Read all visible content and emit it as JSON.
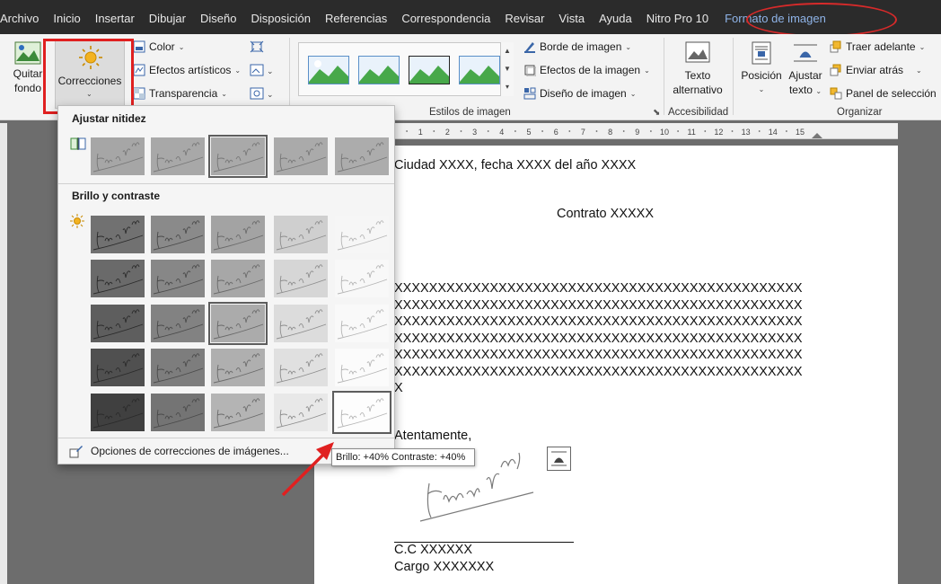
{
  "menu": {
    "tabs": [
      "Archivo",
      "Inicio",
      "Insertar",
      "Dibujar",
      "Diseño",
      "Disposición",
      "Referencias",
      "Correspondencia",
      "Revisar",
      "Vista",
      "Ayuda",
      "Nitro Pro 10"
    ],
    "active_tab": "Formato de imagen"
  },
  "ribbon": {
    "quitar_fondo": [
      "Quitar",
      "fondo"
    ],
    "correcciones": "Correcciones",
    "color": "Color",
    "efectos_artisticos": "Efectos artísticos",
    "transparencia": "Transparencia",
    "borde_imagen": "Borde de imagen",
    "efectos_imagen": "Efectos de la imagen",
    "diseno_imagen": "Diseño de imagen",
    "estilos_label": "Estilos de imagen",
    "texto_alternativo": [
      "Texto",
      "alternativo"
    ],
    "accesibilidad_label": "Accesibilidad",
    "posicion": "Posición",
    "ajustar_texto": [
      "Ajustar",
      "texto"
    ],
    "traer_adelante": "Traer adelante",
    "enviar_atras": "Enviar atrás",
    "panel_seleccion": "Panel de selección",
    "organizar_label": "Organizar"
  },
  "ruler_numbers": [
    "1",
    "2",
    "3",
    "4",
    "5",
    "6",
    "7",
    "8",
    "9",
    "10",
    "11",
    "12",
    "13",
    "14",
    "15"
  ],
  "panel": {
    "nitidez_title": "Ajustar nitidez",
    "brillo_title": "Brillo y contraste",
    "footer": "Opciones de correcciones de imágenes...",
    "tooltip": "Brillo: +40% Contraste: +40%"
  },
  "document": {
    "line1": "Ciudad XXXX, fecha XXXX del año XXXX",
    "title": "Contrato XXXXX",
    "x_lines": [
      "XXXXXXXXXXXXXXXXXXXXXXXXXXXXXXXXXXXXXXXXXXXXXXX",
      "XXXXXXXXXXXXXXXXXXXXXXXXXXXXXXXXXXXXXXXXXXXXXXX",
      "XXXXXXXXXXXXXXXXXXXXXXXXXXXXXXXXXXXXXXXXXXXXXXX",
      "XXXXXXXXXXXXXXXXXXXXXXXXXXXXXXXXXXXXXXXXXXXXXXX",
      "XXXXXXXXXXXXXXXXXXXXXXXXXXXXXXXXXXXXXXXXXXXXXXX",
      "XXXXXXXXXXXXXXXXXXXXXXXXXXXXXXXXXXXXXXXXXXXXXXX",
      "X"
    ],
    "closing": "Atentamente,",
    "cc": "C.C XXXXXX",
    "cargo": "Cargo XXXXXXX"
  },
  "colors": {
    "menubar": "#2b2b2b",
    "active_tab": "#8fb4e8",
    "highlight_red": "#e02020"
  }
}
